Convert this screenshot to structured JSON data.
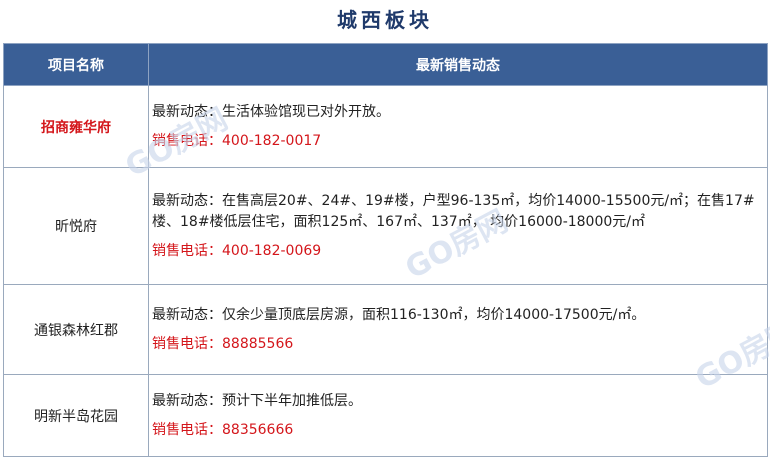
{
  "title": "城西板块",
  "headers": {
    "name": "项目名称",
    "status": "最新销售动态"
  },
  "rows": [
    {
      "name": "招商雍华府",
      "latest": "最新动态：生活体验馆现已对外开放。",
      "phone": "销售电话：400-182-0017"
    },
    {
      "name": "昕悦府",
      "latest": "最新动态：在售高层20#、24#、19#楼，户型96-135㎡，均价14000-15500元/㎡；在售17#楼、18#楼低层住宅，面积125㎡、167㎡、137㎡， 均价16000-18000元/㎡",
      "phone": "销售电话：400-182-0069"
    },
    {
      "name": "通银森林红郡",
      "latest": "最新动态：仅余少量顶底层房源，面积116-130㎡，均价14000-17500元/㎡。",
      "phone": "销售电话：88885566"
    },
    {
      "name": "明新半岛花园",
      "latest": "最新动态：预计下半年加推低层。",
      "phone": "销售电话：88356666"
    }
  ],
  "watermark": "GO房网",
  "colors": {
    "header_bg": "#3a5f96",
    "title": "#1f3a6b",
    "highlight": "#d4161b"
  }
}
